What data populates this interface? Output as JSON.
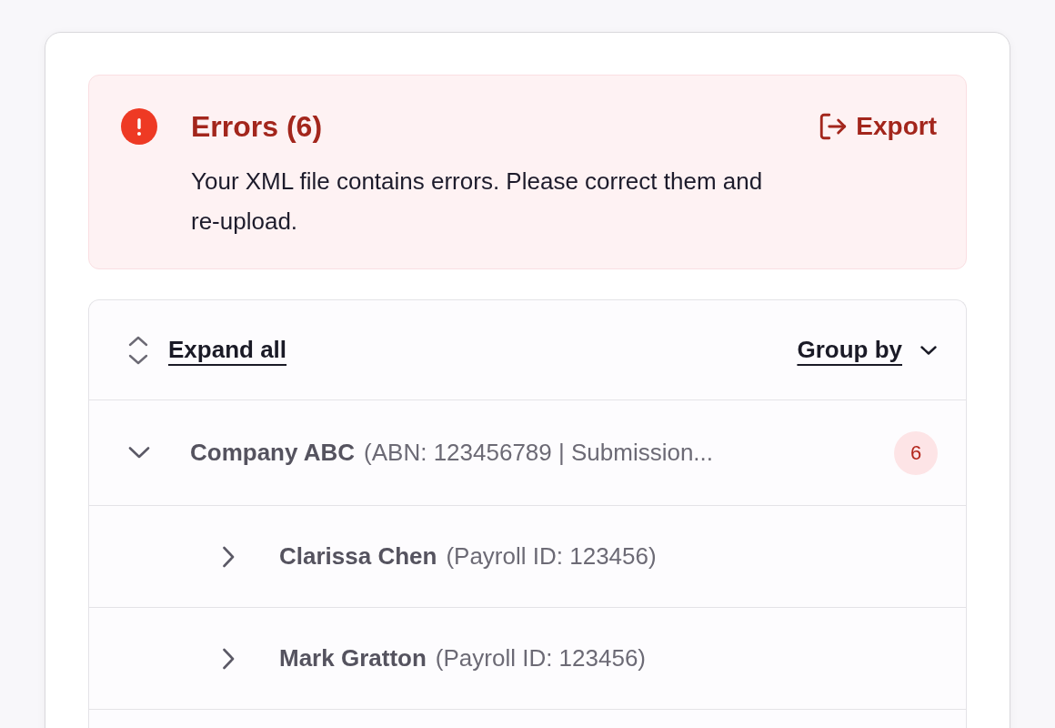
{
  "alert": {
    "title": "Errors (6)",
    "export_label": "Export",
    "message": "Your XML file contains errors. Please correct them and re-upload."
  },
  "toolbar": {
    "expand_all": "Expand all",
    "group_by": "Group by"
  },
  "groups": [
    {
      "name": "Company ABC",
      "detail": "(ABN: 123456789 | Submission...",
      "count": "6",
      "expanded": true,
      "children": [
        {
          "name": "Clarissa Chen",
          "detail": "(Payroll ID: 123456)",
          "expanded": false
        },
        {
          "name": "Mark Gratton",
          "detail": "(Payroll ID: 123456)",
          "expanded": false
        }
      ]
    }
  ]
}
